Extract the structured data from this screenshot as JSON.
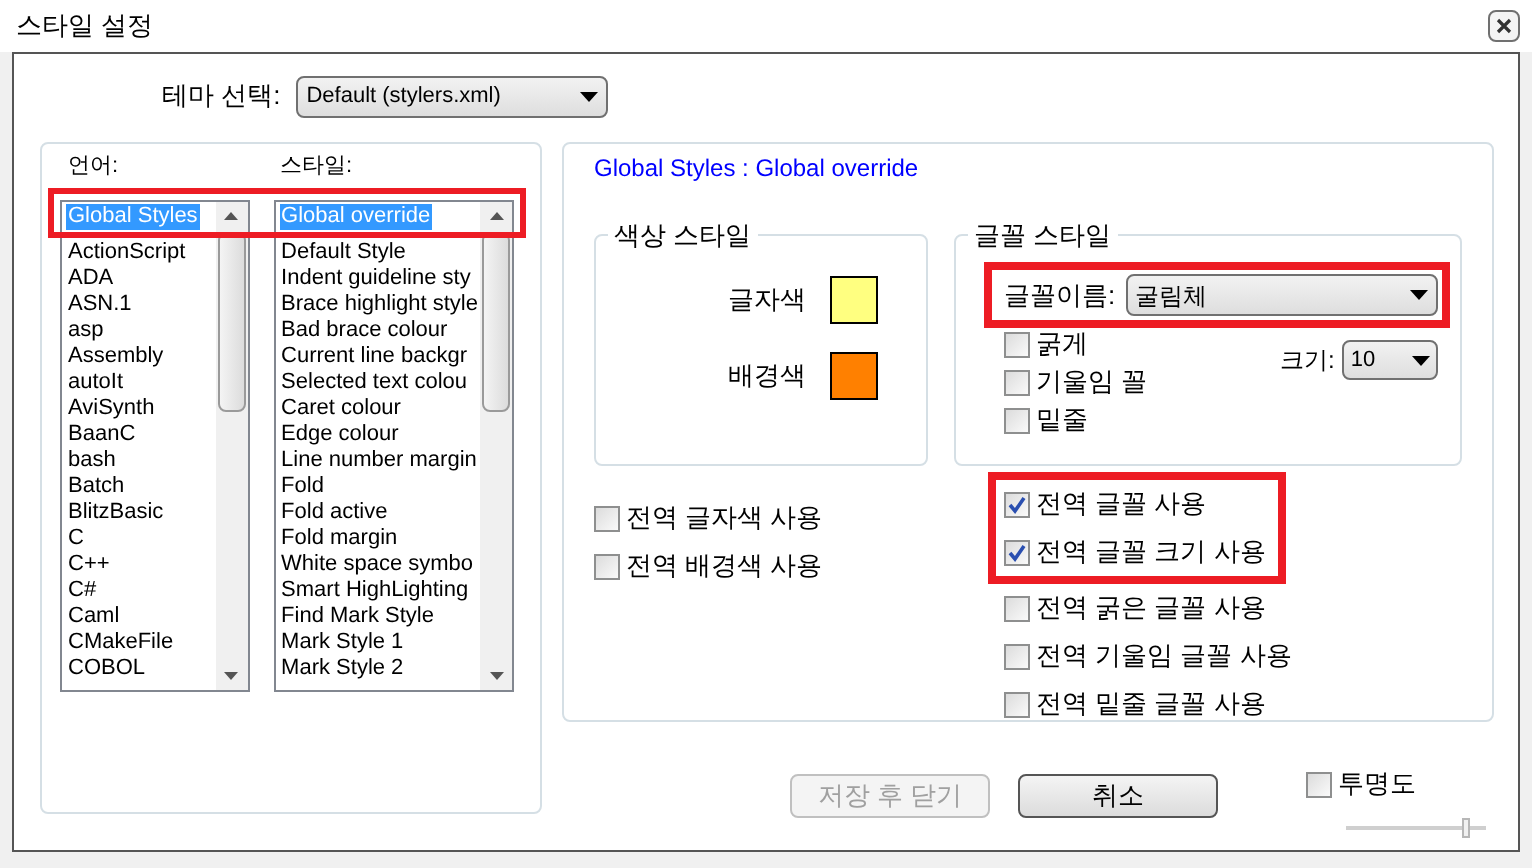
{
  "window": {
    "title": "스타일 설정"
  },
  "theme": {
    "label": "테마 선택:",
    "value": "Default (stylers.xml)"
  },
  "languages": {
    "label": "언어:",
    "items": [
      {
        "text": "Global Styles",
        "selected": true
      },
      {
        "text": "ActionScript",
        "selected": false
      },
      {
        "text": "ADA",
        "selected": false
      },
      {
        "text": "ASN.1",
        "selected": false
      },
      {
        "text": "asp",
        "selected": false
      },
      {
        "text": "Assembly",
        "selected": false
      },
      {
        "text": "autoIt",
        "selected": false
      },
      {
        "text": "AviSynth",
        "selected": false
      },
      {
        "text": "BaanC",
        "selected": false
      },
      {
        "text": "bash",
        "selected": false
      },
      {
        "text": "Batch",
        "selected": false
      },
      {
        "text": "BlitzBasic",
        "selected": false
      },
      {
        "text": "C",
        "selected": false
      },
      {
        "text": "C++",
        "selected": false
      },
      {
        "text": "C#",
        "selected": false
      },
      {
        "text": "Caml",
        "selected": false
      },
      {
        "text": "CMakeFile",
        "selected": false
      },
      {
        "text": "COBOL",
        "selected": false
      }
    ]
  },
  "styles": {
    "label": "스타일:",
    "items": [
      {
        "text": "Global override",
        "selected": true
      },
      {
        "text": "Default Style",
        "selected": false
      },
      {
        "text": "Indent guideline sty",
        "selected": false
      },
      {
        "text": "Brace highlight style",
        "selected": false
      },
      {
        "text": "Bad brace colour",
        "selected": false
      },
      {
        "text": "Current line backgr",
        "selected": false
      },
      {
        "text": "Selected text colou",
        "selected": false
      },
      {
        "text": "Caret colour",
        "selected": false
      },
      {
        "text": "Edge colour",
        "selected": false
      },
      {
        "text": "Line number margin",
        "selected": false
      },
      {
        "text": "Fold",
        "selected": false
      },
      {
        "text": "Fold active",
        "selected": false
      },
      {
        "text": "Fold margin",
        "selected": false
      },
      {
        "text": "White space symbo",
        "selected": false
      },
      {
        "text": "Smart HighLighting",
        "selected": false
      },
      {
        "text": "Find Mark Style",
        "selected": false
      },
      {
        "text": "Mark Style 1",
        "selected": false
      },
      {
        "text": "Mark Style 2",
        "selected": false
      }
    ]
  },
  "heading": "Global Styles : Global override",
  "color_style": {
    "title": "색상 스타일",
    "fields": [
      {
        "label": "글자색",
        "color": "#ffff80"
      },
      {
        "label": "배경색",
        "color": "#ff8000"
      }
    ]
  },
  "font_style": {
    "title": "글꼴 스타일",
    "name_label": "글꼴이름:",
    "name_value": "굴림체",
    "options": [
      {
        "label": "굵게",
        "checked": false
      },
      {
        "label": "기울임 꼴",
        "checked": false
      },
      {
        "label": "밑줄",
        "checked": false
      }
    ],
    "size_label": "크기:",
    "size_value": "10"
  },
  "global_color": [
    {
      "label": "전역 글자색 사용",
      "checked": false
    },
    {
      "label": "전역 배경색 사용",
      "checked": false
    }
  ],
  "global_font": [
    {
      "label": "전역 글꼴 사용",
      "checked": true
    },
    {
      "label": "전역 글꼴 크기 사용",
      "checked": true
    },
    {
      "label": "전역 굵은 글꼴 사용",
      "checked": false
    },
    {
      "label": "전역 기울임 글꼴 사용",
      "checked": false
    },
    {
      "label": "전역 밑줄 글꼴 사용",
      "checked": false
    }
  ],
  "buttons": [
    {
      "label": "저장 후 닫기",
      "disabled": true
    },
    {
      "label": "취소",
      "disabled": false
    }
  ],
  "transparency": {
    "label": "투명도",
    "checked": false,
    "level": 0.85
  }
}
